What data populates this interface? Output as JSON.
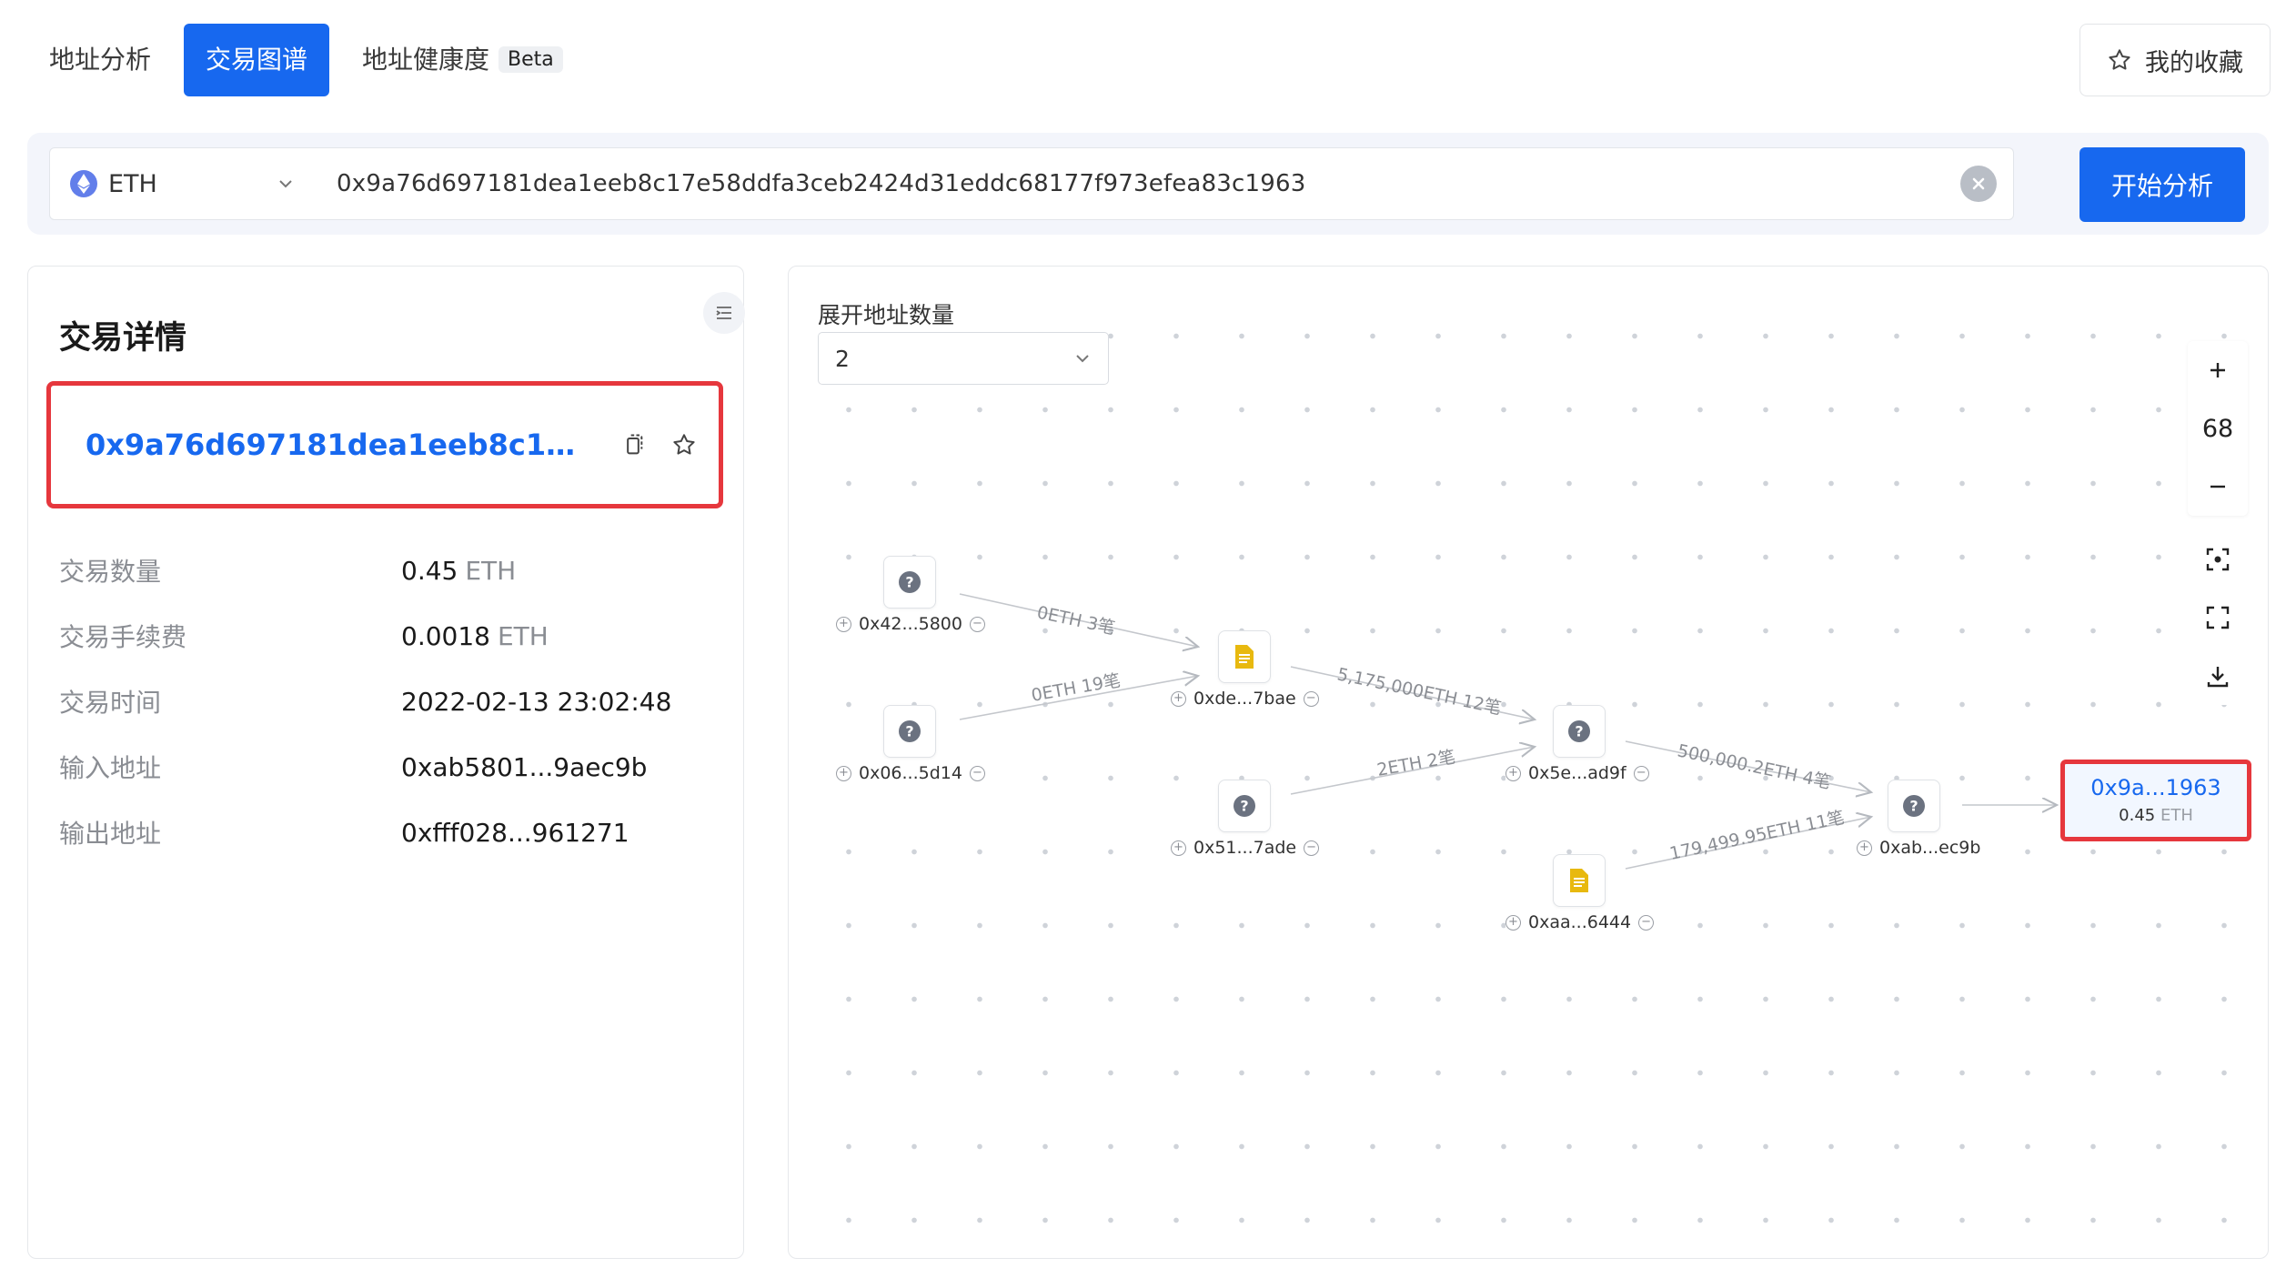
{
  "tabs": {
    "address_analysis": "地址分析",
    "tx_graph": "交易图谱",
    "address_health": "地址健康度",
    "beta": "Beta"
  },
  "favorites_label": "我的收藏",
  "search": {
    "chain": "ETH",
    "value": "0x9a76d697181dea1eeb8c17e58ddfa3ceb2424d31eddc68177f973efea83c1963",
    "analyze_label": "开始分析"
  },
  "details": {
    "title": "交易详情",
    "hash": "0x9a76d697181dea1eeb8c17e58d...",
    "rows": [
      {
        "key": "交易数量",
        "value": "0.45",
        "unit": "ETH"
      },
      {
        "key": "交易手续费",
        "value": "0.0018",
        "unit": "ETH"
      },
      {
        "key": "交易时间",
        "value": "2022-02-13 23:02:48",
        "unit": ""
      },
      {
        "key": "输入地址",
        "value": "0xab5801...9aec9b",
        "unit": ""
      },
      {
        "key": "输出地址",
        "value": "0xfff028...961271",
        "unit": ""
      }
    ]
  },
  "graph": {
    "expand_label": "展开地址数量",
    "expand_value": "2",
    "zoom": "68",
    "nodes": [
      {
        "label": "0x42...5800",
        "kind": "unknown"
      },
      {
        "label": "0x06...5d14",
        "kind": "unknown"
      },
      {
        "label": "0xde...7bae",
        "kind": "contract"
      },
      {
        "label": "0x51...7ade",
        "kind": "unknown"
      },
      {
        "label": "0x5e...ad9f",
        "kind": "unknown"
      },
      {
        "label": "0xaa...6444",
        "kind": "contract"
      },
      {
        "label": "0xab...ec9b",
        "kind": "unknown"
      }
    ],
    "edges": [
      {
        "label": "0ETH 3笔"
      },
      {
        "label": "0ETH 19笔"
      },
      {
        "label": "5,175,000ETH 12笔"
      },
      {
        "label": "2ETH 2笔"
      },
      {
        "label": "500,000.2ETH 4笔"
      },
      {
        "label": "179,499.95ETH 11笔"
      }
    ],
    "target": {
      "address": "0x9a...1963",
      "amount": "0.45",
      "unit": "ETH"
    }
  }
}
